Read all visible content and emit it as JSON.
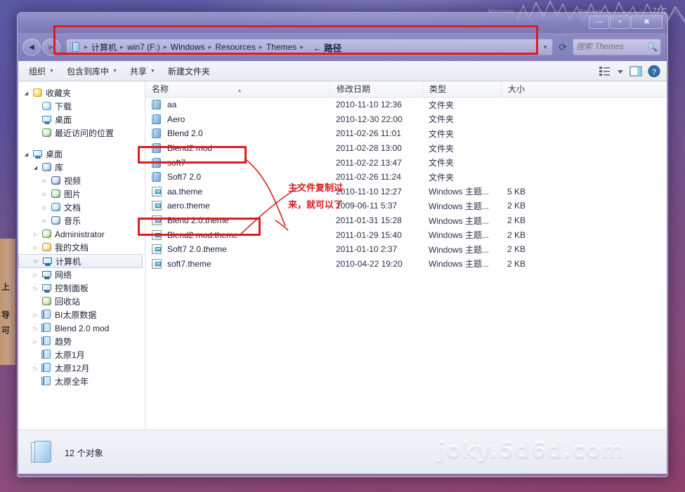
{
  "desktop": {
    "gadget": {
      "minimize": "Minimize",
      "refresh": "Refresh",
      "temperature": "7°C"
    },
    "left_icon_fragments": [
      "上",
      "导",
      "可"
    ]
  },
  "window": {
    "controls": {
      "minimize": "—",
      "maximize": "+",
      "close": "✖"
    }
  },
  "address_bar": {
    "back": "◀",
    "forward": "▶",
    "crumbs": [
      "计算机",
      "win7 (F:)",
      "Windows",
      "Resources",
      "Themes"
    ],
    "separator": "▸",
    "annotation": "← 路径",
    "dropdown": "▾",
    "refresh": "⟳"
  },
  "search": {
    "placeholder": "搜索 Themes",
    "value": "",
    "icon": "search-icon"
  },
  "toolbar": {
    "items": [
      {
        "label": "组织",
        "has_caret": true
      },
      {
        "label": "包含到库中",
        "has_caret": true
      },
      {
        "label": "共享",
        "has_caret": true
      },
      {
        "label": "新建文件夹",
        "has_caret": false
      }
    ],
    "right_icons": [
      "view-list-icon",
      "view-dropdown-caret",
      "preview-pane-icon",
      "help-icon"
    ]
  },
  "sidebar": {
    "groups": [
      {
        "items": [
          {
            "label": "收藏夹",
            "indent": 0,
            "twisty": "open",
            "icon": "favorites-icon",
            "selected": false
          },
          {
            "label": "下载",
            "indent": 1,
            "twisty": "none",
            "icon": "downloads-icon",
            "selected": false
          },
          {
            "label": "桌面",
            "indent": 1,
            "twisty": "none",
            "icon": "desktop-icon",
            "selected": false
          },
          {
            "label": "最近访问的位置",
            "indent": 1,
            "twisty": "none",
            "icon": "recent-places-icon",
            "selected": false
          }
        ]
      },
      {
        "items": [
          {
            "label": "桌面",
            "indent": 0,
            "twisty": "open",
            "icon": "desktop-icon",
            "selected": false
          },
          {
            "label": "库",
            "indent": 1,
            "twisty": "open",
            "icon": "library-icon",
            "selected": false
          },
          {
            "label": "视频",
            "indent": 2,
            "twisty": "closed",
            "icon": "video-icon",
            "selected": false
          },
          {
            "label": "图片",
            "indent": 2,
            "twisty": "closed",
            "icon": "pictures-icon",
            "selected": false
          },
          {
            "label": "文档",
            "indent": 2,
            "twisty": "closed",
            "icon": "documents-icon",
            "selected": false
          },
          {
            "label": "音乐",
            "indent": 2,
            "twisty": "closed",
            "icon": "music-icon",
            "selected": false
          },
          {
            "label": "Administrator",
            "indent": 1,
            "twisty": "closed",
            "icon": "user-icon",
            "selected": false
          },
          {
            "label": "我的文档",
            "indent": 1,
            "twisty": "closed",
            "icon": "mydocs-icon",
            "selected": false
          },
          {
            "label": "计算机",
            "indent": 1,
            "twisty": "closed",
            "icon": "computer-icon",
            "selected": true
          },
          {
            "label": "网络",
            "indent": 1,
            "twisty": "closed",
            "icon": "network-icon",
            "selected": false
          },
          {
            "label": "控制面板",
            "indent": 1,
            "twisty": "closed",
            "icon": "control-panel-icon",
            "selected": false
          },
          {
            "label": "回收站",
            "indent": 1,
            "twisty": "none",
            "icon": "recycle-bin-icon",
            "selected": false
          },
          {
            "label": "BI太原数据",
            "indent": 1,
            "twisty": "closed",
            "icon": "folder-icon",
            "selected": false
          },
          {
            "label": "Blend 2.0 mod",
            "indent": 1,
            "twisty": "closed",
            "icon": "folder-icon",
            "selected": false
          },
          {
            "label": "趋势",
            "indent": 1,
            "twisty": "closed",
            "icon": "folder-icon",
            "selected": false
          },
          {
            "label": "太原1月",
            "indent": 1,
            "twisty": "none",
            "icon": "folder-icon",
            "selected": false
          },
          {
            "label": "太原12月",
            "indent": 1,
            "twisty": "closed",
            "icon": "folder-icon",
            "selected": false
          },
          {
            "label": "太原全年",
            "indent": 1,
            "twisty": "none",
            "icon": "folder-icon",
            "selected": false
          }
        ]
      }
    ]
  },
  "file_list": {
    "columns": [
      "名称",
      "修改日期",
      "类型",
      "大小"
    ],
    "sort_indicator": "▲",
    "rows": [
      {
        "name": "aa",
        "date": "2010-11-10 12:36",
        "type": "文件夹",
        "size": "",
        "icon": "folder-icon"
      },
      {
        "name": "Aero",
        "date": "2010-12-30 22:00",
        "type": "文件夹",
        "size": "",
        "icon": "folder-icon"
      },
      {
        "name": "Blend 2.0",
        "date": "2011-02-26 11:01",
        "type": "文件夹",
        "size": "",
        "icon": "folder-icon"
      },
      {
        "name": "Blend2 mod",
        "date": "2011-02-28 13:00",
        "type": "文件夹",
        "size": "",
        "icon": "folder-icon"
      },
      {
        "name": "soft7",
        "date": "2011-02-22 13:47",
        "type": "文件夹",
        "size": "",
        "icon": "folder-icon"
      },
      {
        "name": "Soft7 2.0",
        "date": "2011-02-26 11:24",
        "type": "文件夹",
        "size": "",
        "icon": "folder-icon"
      },
      {
        "name": "aa.theme",
        "date": "2010-11-10 12:27",
        "type": "Windows 主题...",
        "size": "5 KB",
        "icon": "theme-file-icon"
      },
      {
        "name": "aero.theme",
        "date": "2009-06-11 5:37",
        "type": "Windows 主题...",
        "size": "2 KB",
        "icon": "theme-file-icon"
      },
      {
        "name": "Blend 2.0.theme",
        "date": "2011-01-31 15:28",
        "type": "Windows 主题...",
        "size": "2 KB",
        "icon": "theme-file-icon"
      },
      {
        "name": "Blend2 mod.theme",
        "date": "2011-01-29 15:40",
        "type": "Windows 主题...",
        "size": "2 KB",
        "icon": "theme-file-icon"
      },
      {
        "name": "Soft7 2.0.theme",
        "date": "2011-01-10 2:37",
        "type": "Windows 主题...",
        "size": "2 KB",
        "icon": "theme-file-icon"
      },
      {
        "name": "soft7.theme",
        "date": "2010-04-22 19:20",
        "type": "Windows 主题...",
        "size": "2 KB",
        "icon": "theme-file-icon"
      }
    ]
  },
  "status_bar": {
    "text": "12 个对象",
    "watermark": "joky.5d6d.com"
  },
  "annotations": {
    "note": "主文件复制过来，就可以了",
    "highlight_color": "#e01b1b"
  }
}
